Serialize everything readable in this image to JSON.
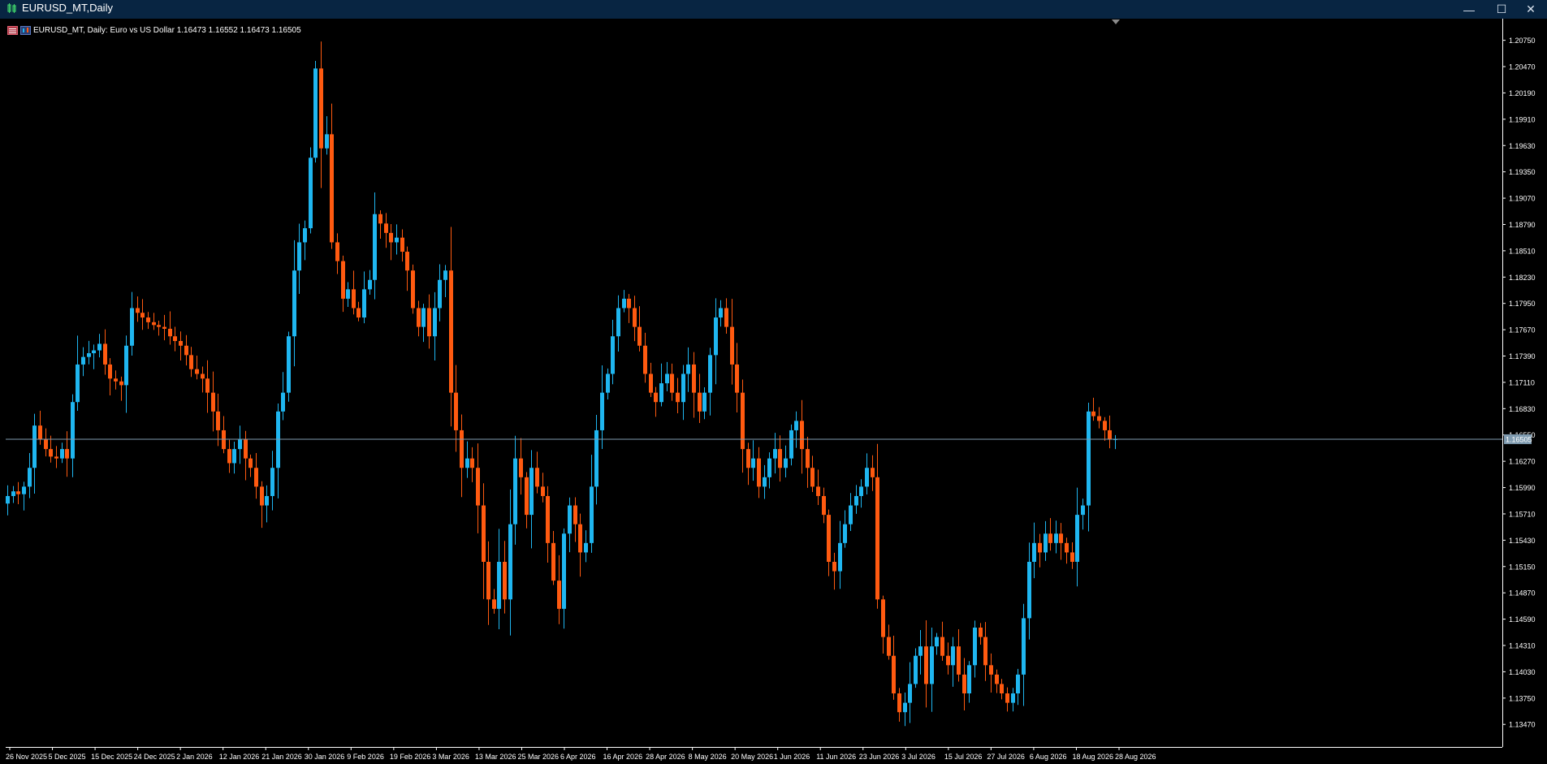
{
  "window": {
    "title": "EURUSD_MT,Daily",
    "minimize_glyph": "—",
    "maximize_glyph": "☐",
    "close_glyph": "✕"
  },
  "legend": {
    "symbol_text": "EURUSD_MT, Daily:  Euro vs US Dollar  1.16473 1.16552 1.16473 1.16505"
  },
  "colors": {
    "background": "#000000",
    "bull": "#1fb6f0",
    "bear": "#ff5a10",
    "axis_text": "#ffffff",
    "bid_line": "#7f9bb0",
    "price_tag_bg": "#7f9bb0",
    "titlebar": "#082542"
  },
  "chart_data": {
    "type": "candlestick",
    "symbol": "EURUSD_MT",
    "timeframe": "Daily",
    "description": "Euro vs US Dollar",
    "last_ohlc": {
      "open": 1.16473,
      "high": 1.16552,
      "low": 1.16473,
      "close": 1.16505
    },
    "current_price_label": "1.16505",
    "current_price": 1.16505,
    "y_ticks": [
      1.2075,
      1.2047,
      1.2019,
      1.1991,
      1.1963,
      1.1935,
      1.1907,
      1.1879,
      1.1851,
      1.1823,
      1.1795,
      1.1767,
      1.1739,
      1.1711,
      1.1683,
      1.1655,
      1.1627,
      1.1599,
      1.1571,
      1.1543,
      1.1515,
      1.1487,
      1.1459,
      1.1431,
      1.1403,
      1.1375,
      1.1347
    ],
    "y_tick_labels": [
      "1.20750",
      "1.20470",
      "1.20190",
      "1.19910",
      "1.19630",
      "1.19350",
      "1.19070",
      "1.18790",
      "1.18510",
      "1.18230",
      "1.17950",
      "1.17670",
      "1.17390",
      "1.17110",
      "1.16830",
      "1.16550",
      "1.16270",
      "1.15990",
      "1.15710",
      "1.15430",
      "1.15150",
      "1.14870",
      "1.14590",
      "1.14310",
      "1.14030",
      "1.13750",
      "1.13470"
    ],
    "x_tick_labels": [
      "26 Nov 2025",
      "5 Dec 2025",
      "15 Dec 2025",
      "24 Dec 2025",
      "2 Jan 2026",
      "12 Jan 2026",
      "21 Jan 2026",
      "30 Jan 2026",
      "9 Feb 2026",
      "19 Feb 2026",
      "3 Mar 2026",
      "13 Mar 2026",
      "25 Mar 2026",
      "6 Apr 2026",
      "16 Apr 2026",
      "28 Apr 2026",
      "8 May 2026",
      "20 May 2026",
      "1 Jun 2026",
      "11 Jun 2026",
      "23 Jun 2026",
      "3 Jul 2026",
      "15 Jul 2026",
      "27 Jul 2026",
      "6 Aug 2026",
      "18 Aug 2026",
      "28 Aug 2026"
    ],
    "ylim": [
      1.1323,
      1.2098
    ],
    "close_path": [
      1.159,
      1.1595,
      1.1592,
      1.16,
      1.162,
      1.1665,
      1.165,
      1.164,
      1.1632,
      1.163,
      1.164,
      1.163,
      1.169,
      1.173,
      1.1738,
      1.1742,
      1.1745,
      1.1752,
      1.173,
      1.1715,
      1.1712,
      1.1708,
      1.175,
      1.179,
      1.1785,
      1.178,
      1.1775,
      1.1772,
      1.177,
      1.1768,
      1.176,
      1.1755,
      1.175,
      1.174,
      1.1725,
      1.172,
      1.1715,
      1.17,
      1.168,
      1.166,
      1.164,
      1.1625,
      1.164,
      1.165,
      1.163,
      1.162,
      1.16,
      1.158,
      1.159,
      1.162,
      1.168,
      1.17,
      1.176,
      1.183,
      1.186,
      1.1875,
      1.195,
      1.2045,
      1.196,
      1.1975,
      1.186,
      1.184,
      1.18,
      1.181,
      1.179,
      1.178,
      1.181,
      1.182,
      1.189,
      1.188,
      1.187,
      1.186,
      1.1865,
      1.185,
      1.183,
      1.179,
      1.177,
      1.179,
      1.176,
      1.179,
      1.182,
      1.183,
      1.17,
      1.166,
      1.162,
      1.163,
      1.162,
      1.158,
      1.152,
      1.148,
      1.147,
      1.152,
      1.148,
      1.156,
      1.163,
      1.161,
      1.157,
      1.162,
      1.16,
      1.159,
      1.154,
      1.15,
      1.147,
      1.155,
      1.158,
      1.156,
      1.153,
      1.154,
      1.16,
      1.166,
      1.17,
      1.172,
      1.176,
      1.179,
      1.18,
      1.179,
      1.177,
      1.175,
      1.172,
      1.17,
      1.169,
      1.171,
      1.172,
      1.17,
      1.169,
      1.172,
      1.173,
      1.17,
      1.168,
      1.17,
      1.174,
      1.178,
      1.179,
      1.177,
      1.173,
      1.17,
      1.164,
      1.162,
      1.163,
      1.16,
      1.161,
      1.163,
      1.164,
      1.162,
      1.163,
      1.166,
      1.167,
      1.164,
      1.162,
      1.16,
      1.159,
      1.157,
      1.152,
      1.151,
      1.154,
      1.156,
      1.158,
      1.159,
      1.16,
      1.162,
      1.161,
      1.148,
      1.144,
      1.142,
      1.138,
      1.136,
      1.137,
      1.139,
      1.142,
      1.143,
      1.139,
      1.143,
      1.144,
      1.142,
      1.141,
      1.143,
      1.14,
      1.138,
      1.141,
      1.145,
      1.144,
      1.141,
      1.14,
      1.139,
      1.138,
      1.137,
      1.138,
      1.14,
      1.146,
      1.152,
      1.154,
      1.153,
      1.155,
      1.154,
      1.155,
      1.154,
      1.153,
      1.152,
      1.157,
      1.158,
      1.168,
      1.1675,
      1.167,
      1.166,
      1.165,
      1.16505
    ]
  }
}
